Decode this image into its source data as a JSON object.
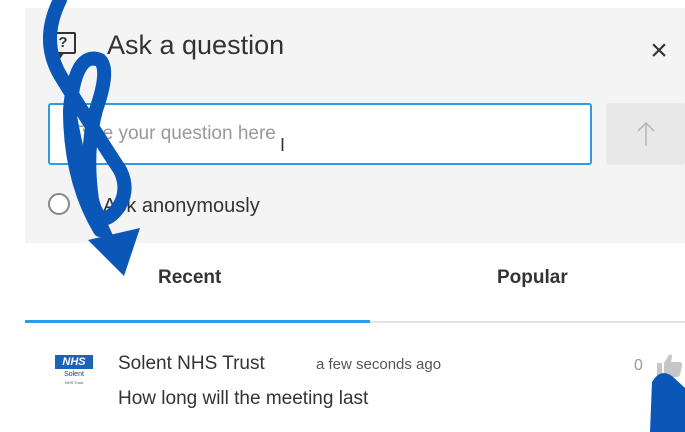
{
  "header": {
    "title": "Ask a question",
    "question_icon_glyph": "?",
    "close_icon": "close-icon",
    "close_glyph": "×"
  },
  "question_form": {
    "input_value": "",
    "placeholder": "Type your question here",
    "send_icon": "arrow-up-icon",
    "anonymous_label": "Ask anonymously",
    "anonymous_checked": false
  },
  "tabs": [
    {
      "label": "Recent",
      "active": true
    },
    {
      "label": "Popular",
      "active": false
    }
  ],
  "questions": [
    {
      "avatar": {
        "logo_text": "NHS",
        "org_line": "Solent",
        "sub_line": "NHS Trust"
      },
      "author": "Solent NHS Trust",
      "time": "a few seconds ago",
      "text": "How long will the meeting last",
      "likes": "0"
    }
  ],
  "colors": {
    "accent": "#2e9be6",
    "panel_bg": "#f4f4f4",
    "decoration": "#0b57b8",
    "nhs_blue": "#1a63b8"
  }
}
